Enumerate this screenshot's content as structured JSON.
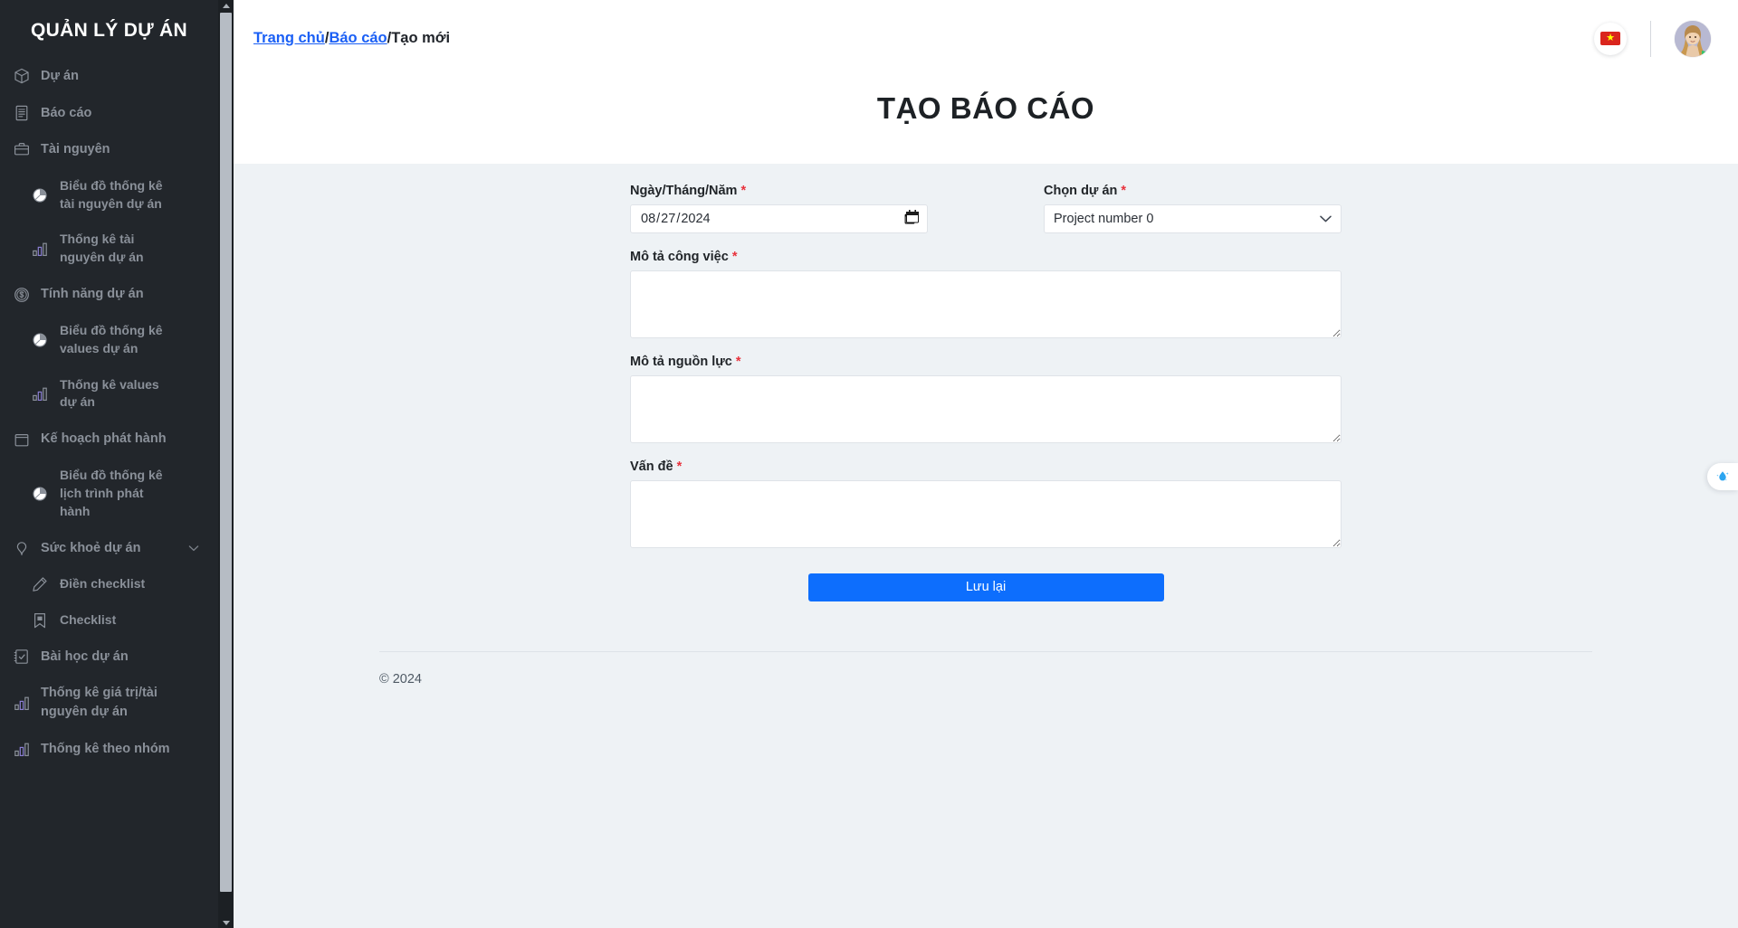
{
  "sidebar": {
    "brand": "QUẢN LÝ DỰ ÁN",
    "items": [
      {
        "label": "Dự án",
        "icon": "cube-icon",
        "sub": false
      },
      {
        "label": "Báo cáo",
        "icon": "document-icon",
        "sub": false
      },
      {
        "label": "Tài nguyên",
        "icon": "briefcase-icon",
        "sub": false
      },
      {
        "label": "Biểu đồ thống kê tài nguyên dự án",
        "icon": "pie-chart-icon",
        "sub": true
      },
      {
        "label": "Thống kê tài nguyên dự án",
        "icon": "bar-chart-icon",
        "sub": true
      },
      {
        "label": "Tính năng dự án",
        "icon": "dollar-coin-icon",
        "sub": false
      },
      {
        "label": "Biểu đồ thống kê values dự án",
        "icon": "pie-chart-icon",
        "sub": true
      },
      {
        "label": "Thống kê values dự án",
        "icon": "bar-chart-icon",
        "sub": true
      },
      {
        "label": "Kế hoạch phát hành",
        "icon": "calendar-icon",
        "sub": false
      },
      {
        "label": "Biểu đồ thống kê lịch trình phát hành",
        "icon": "pie-chart-icon",
        "sub": true
      },
      {
        "label": "Sức khoẻ dự án",
        "icon": "heart-pin-icon",
        "sub": false,
        "chevron": "chevron-down-icon"
      },
      {
        "label": "Điền checklist",
        "icon": "pencil-icon",
        "sub": true
      },
      {
        "label": "Checklist",
        "icon": "bookmark-icon",
        "sub": true
      },
      {
        "label": "Bài học dự án",
        "icon": "clipboard-check-icon",
        "sub": false
      },
      {
        "label": "Thống kê giá trị/tài nguyên dự án",
        "icon": "bar-chart-icon",
        "sub": false
      },
      {
        "label": "Thống kê theo nhóm",
        "icon": "bar-chart-icon",
        "sub": false
      }
    ]
  },
  "topbar": {
    "breadcrumb": {
      "home": "Trang chủ",
      "section": "Báo cáo",
      "current": "Tạo mới",
      "separator": "/"
    },
    "language_flag": "vietnam-flag-icon",
    "avatar": "user-avatar"
  },
  "page": {
    "title": "TẠO BÁO CÁO"
  },
  "form": {
    "date": {
      "label": "Ngày/Tháng/Năm",
      "required_mark": "*",
      "value": "2024-08-27",
      "display_value": "08/27/2024",
      "icon": "calendar-icon"
    },
    "project": {
      "label": "Chọn dự án",
      "required_mark": "*",
      "selected": "Project number 0",
      "options": [
        "Project number 0"
      ],
      "icon": "chevron-down-icon"
    },
    "work_description": {
      "label": "Mô tả công việc",
      "required_mark": "*",
      "value": "",
      "placeholder": ""
    },
    "resource_description": {
      "label": "Mô tả nguồn lực",
      "required_mark": "*",
      "value": "",
      "placeholder": ""
    },
    "issue": {
      "label": "Vấn đề",
      "required_mark": "*",
      "value": "",
      "placeholder": ""
    },
    "save_label": "Lưu lại"
  },
  "footer": {
    "copyright": "© 2024"
  },
  "side_widget": {
    "icon": "water-drop-icon"
  },
  "colors": {
    "sidebar_bg": "#22262b",
    "sidebar_text": "#8a9099",
    "link": "#1a5ff5",
    "primary_button": "#0d6efd",
    "required": "#e8323c",
    "content_bg": "#eef2f5"
  }
}
